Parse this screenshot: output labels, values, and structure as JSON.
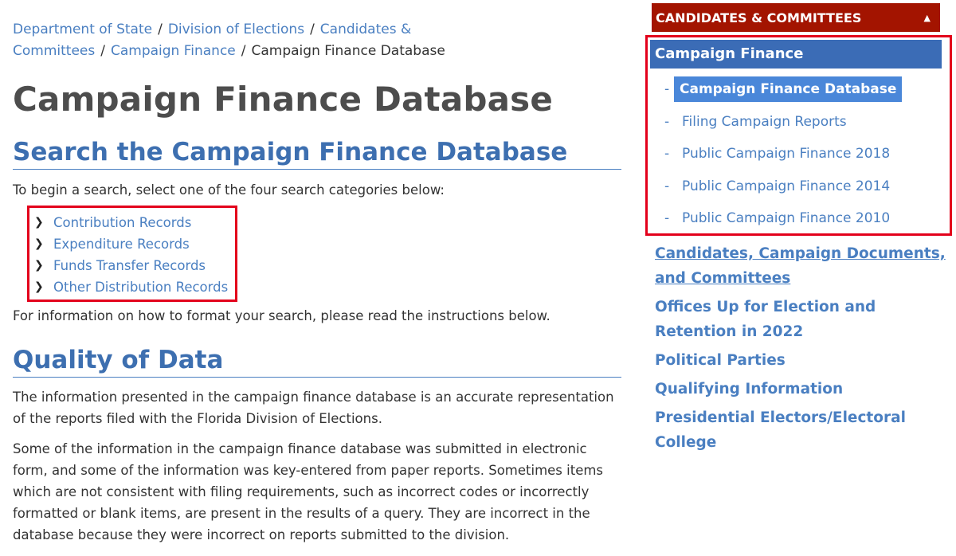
{
  "breadcrumb": {
    "items": [
      "Department of State",
      "Division of Elections",
      "Candidates & Committees",
      "Campaign Finance"
    ],
    "current": "Campaign Finance Database",
    "separator": "/"
  },
  "page_title": "Campaign Finance Database",
  "search_section": {
    "heading": "Search the Campaign Finance Database",
    "intro": "To begin a search, select one of the four search categories below:",
    "categories": [
      "Contribution Records",
      "Expenditure Records",
      "Funds Transfer Records",
      "Other Distribution Records"
    ],
    "footer": "For information on how to format your search, please read the instructions below."
  },
  "quality_section": {
    "heading": "Quality of Data",
    "para1": "The information presented in the campaign finance database is an accurate representation of the reports filed with the Florida Division of Elections.",
    "para2": "Some of the information in the campaign finance database was submitted in electronic form, and some of the information was key-entered from paper reports. Sometimes items which are not consistent with filing requirements, such as incorrect codes or incorrectly formatted or blank items, are present in the results of a query. They are incorrect in the database because they were incorrect on reports submitted to the division."
  },
  "sidebar": {
    "header": "CANDIDATES & COMMITTEES",
    "header_icon": "caret-up-icon",
    "active_section": "Campaign Finance",
    "sub_items": [
      {
        "label": "Campaign Finance Database",
        "current": true
      },
      {
        "label": "Filing Campaign Reports",
        "current": false
      },
      {
        "label": "Public Campaign Finance 2018",
        "current": false
      },
      {
        "label": "Public Campaign Finance 2014",
        "current": false
      },
      {
        "label": "Public Campaign Finance 2010",
        "current": false
      }
    ],
    "dash": "-",
    "links": [
      "Candidates, Campaign Documents, and Committees",
      "Offices Up for Election and Retention in 2022",
      "Political Parties",
      "Qualifying Information",
      "Presidential Electors/Electoral College"
    ]
  },
  "colors": {
    "link": "#4a7fc1",
    "heading_blue": "#3d6fb0",
    "header_red": "#a31400",
    "highlight_red": "#e3001b",
    "active_blue": "#3b6cb6"
  }
}
